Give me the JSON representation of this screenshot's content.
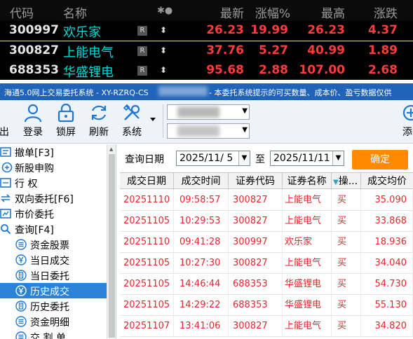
{
  "quote_panel": {
    "headers": {
      "code": "代码",
      "name": "名称",
      "icons": "✱●",
      "latest": "最新",
      "change_pct": "涨幅%",
      "high": "最高",
      "change": "涨跌"
    },
    "rows": [
      {
        "code": "300997",
        "name": "欢乐家",
        "badge": "R",
        "arrow": "⬍",
        "latest": "26.23",
        "change_pct": "19.99",
        "high": "26.23",
        "change": "4.37"
      },
      {
        "code": "300827",
        "name": "上能电气",
        "badge": "R",
        "arrow": "⬍",
        "latest": "37.76",
        "change_pct": "5.27",
        "high": "40.99",
        "change": "1.89"
      },
      {
        "code": "688353",
        "name": "华盛锂电",
        "badge": "R",
        "arrow": "⬍",
        "latest": "95.68",
        "change_pct": "2.88",
        "high": "107.00",
        "change": "2.68"
      }
    ],
    "colors": {
      "up": "#ff3b3b",
      "name": "#00d8d8",
      "background": "#000000"
    }
  },
  "titlebar": {
    "left": "海通5.0网上交易委托系统 - XY-RZRQ-CS",
    "right": "- 本委托系统提示的可买数量、成本价、盈亏数据仅供"
  },
  "toolbar": {
    "items": [
      {
        "label": "出",
        "icon": "exit-icon"
      },
      {
        "label": "登录",
        "icon": "user-icon"
      },
      {
        "label": "锁屏",
        "icon": "lock-icon"
      },
      {
        "label": "刷新",
        "icon": "refresh-icon"
      },
      {
        "label": "系统",
        "icon": "tools-icon"
      },
      {
        "label": "添",
        "icon": "add-icon"
      }
    ]
  },
  "sidebar": {
    "items": [
      {
        "label": "撤单[F3]",
        "icon": "cancel-order-icon"
      },
      {
        "label": "新股申购",
        "icon": "new-stock-icon"
      },
      {
        "label": "行      权",
        "icon": "exercise-icon"
      },
      {
        "label": "双向委托[F6]",
        "icon": "two-way-icon"
      },
      {
        "label": "市价委托",
        "icon": "market-order-icon"
      },
      {
        "label": "查询[F4]",
        "icon": "search-icon"
      },
      {
        "label": "资金股票",
        "icon": "list-icon"
      },
      {
        "label": "当日成交",
        "icon": "yen-icon"
      },
      {
        "label": "当日委托",
        "icon": "document-icon"
      },
      {
        "label": "历史成交",
        "icon": "yen-icon",
        "selected": true
      },
      {
        "label": "历史委托",
        "icon": "document-icon"
      },
      {
        "label": "资金明细",
        "icon": "list-icon"
      },
      {
        "label": "交 割 单",
        "icon": "list-icon"
      }
    ]
  },
  "query": {
    "date_label": "查询日期",
    "start_date": "2025/11/  5",
    "to_label": "至",
    "end_date": "2025/11/11",
    "confirm_label": "确定"
  },
  "table": {
    "columns": [
      "成交日期",
      "成交时间",
      "证券代码",
      "证券名称",
      "操...",
      "成交均价"
    ],
    "rows": [
      {
        "date": "20251110",
        "time": "09:58:57",
        "code": "300827",
        "name": "上能电气",
        "op": "买",
        "price": "35.090"
      },
      {
        "date": "20251105",
        "time": "10:29:53",
        "code": "300827",
        "name": "上能电气",
        "op": "买",
        "price": "33.868"
      },
      {
        "date": "20251110",
        "time": "09:41:28",
        "code": "300997",
        "name": "欢乐家",
        "op": "买",
        "price": "18.936"
      },
      {
        "date": "20251105",
        "time": "10:27:30",
        "code": "300827",
        "name": "上能电气",
        "op": "买",
        "price": "34.040"
      },
      {
        "date": "20251105",
        "time": "14:46:44",
        "code": "688353",
        "name": "华盛锂电",
        "op": "买",
        "price": "54.730"
      },
      {
        "date": "20251105",
        "time": "14:29:22",
        "code": "688353",
        "name": "华盛锂电",
        "op": "买",
        "price": "55.130"
      },
      {
        "date": "20251107",
        "time": "13:41:06",
        "code": "300827",
        "name": "上能电气",
        "op": "买",
        "price": "34.820"
      }
    ],
    "colors": {
      "buy": "#e8262b"
    }
  }
}
